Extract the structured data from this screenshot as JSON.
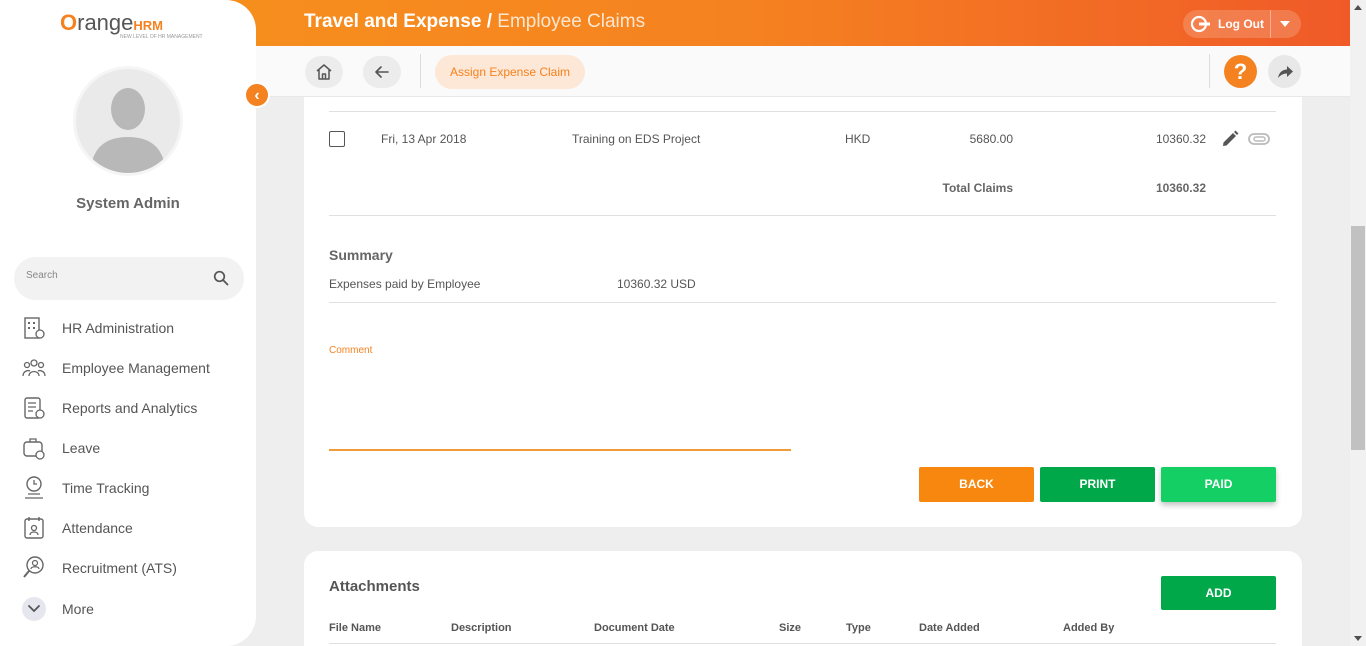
{
  "header": {
    "title_main": "Travel and Expense / ",
    "title_sub": "Employee Claims",
    "logout_label": "Log Out"
  },
  "toolbar": {
    "assign_label": "Assign Expense Claim",
    "help_label": "?"
  },
  "sidebar": {
    "logo_prefix": "range",
    "logo_o": "O",
    "logo_hrm": "HRM",
    "logo_tagline": "NEW LEVEL OF HR MANAGEMENT",
    "username": "System Admin",
    "search_placeholder": "Search",
    "items": [
      {
        "label": "HR Administration",
        "icon": "building-icon"
      },
      {
        "label": "Employee Management",
        "icon": "people-icon"
      },
      {
        "label": "Reports and Analytics",
        "icon": "report-icon"
      },
      {
        "label": "Leave",
        "icon": "leave-icon"
      },
      {
        "label": "Time Tracking",
        "icon": "clock-icon"
      },
      {
        "label": "Attendance",
        "icon": "calendar-icon"
      },
      {
        "label": "Recruitment (ATS)",
        "icon": "recruit-icon"
      },
      {
        "label": "More",
        "icon": "chevron-down-icon"
      }
    ]
  },
  "claim_row": {
    "date": "Fri, 13 Apr 2018",
    "description": "Training on EDS Project",
    "currency": "HKD",
    "amount": "5680.00",
    "converted": "10360.32"
  },
  "totals": {
    "label": "Total Claims",
    "value": "10360.32"
  },
  "summary": {
    "title": "Summary",
    "row_label": "Expenses paid by Employee",
    "row_value": "10360.32 USD"
  },
  "comment": {
    "label": "Comment",
    "value": ""
  },
  "actions": {
    "back": "BACK",
    "print": "PRINT",
    "paid": "PAID"
  },
  "attachments": {
    "title": "Attachments",
    "add": "ADD",
    "columns": [
      "File Name",
      "Description",
      "Document Date",
      "Size",
      "Type",
      "Date Added",
      "Added By"
    ]
  },
  "colors": {
    "brand_orange": "#f58220",
    "green": "#00a84a",
    "light_green": "#13cf64"
  }
}
